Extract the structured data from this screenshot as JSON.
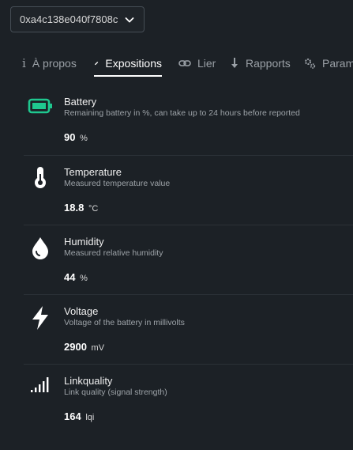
{
  "device": {
    "selected": "0xa4c138e040f7808c",
    "chevron_icon": "chevron-down-icon"
  },
  "tabs": [
    {
      "label": "À propos",
      "icon": "info-icon",
      "active": false
    },
    {
      "label": "Expositions",
      "icon": "pencil-icon",
      "active": true
    },
    {
      "label": "Lier",
      "icon": "link-icon",
      "active": false
    },
    {
      "label": "Rapports",
      "icon": "download-arrow-icon",
      "active": false
    },
    {
      "label": "Paramè",
      "icon": "gears-icon",
      "active": false
    }
  ],
  "expositions": [
    {
      "name": "Battery",
      "description": "Remaining battery in %, can take up to 24 hours before reported",
      "value": "90",
      "unit": "%",
      "icon": "battery-full-icon",
      "color": "#1fc88f"
    },
    {
      "name": "Temperature",
      "description": "Measured temperature value",
      "value": "18.8",
      "unit": "°C",
      "icon": "thermometer-icon",
      "color": "#ffffff"
    },
    {
      "name": "Humidity",
      "description": "Measured relative humidity",
      "value": "44",
      "unit": "%",
      "icon": "water-drop-icon",
      "color": "#ffffff"
    },
    {
      "name": "Voltage",
      "description": "Voltage of the battery in millivolts",
      "value": "2900",
      "unit": "mV",
      "icon": "lightning-bolt-icon",
      "color": "#ffffff"
    },
    {
      "name": "Linkquality",
      "description": "Link quality (signal strength)",
      "value": "164",
      "unit": "lqi",
      "icon": "signal-bars-icon",
      "color": "#ffffff"
    }
  ]
}
